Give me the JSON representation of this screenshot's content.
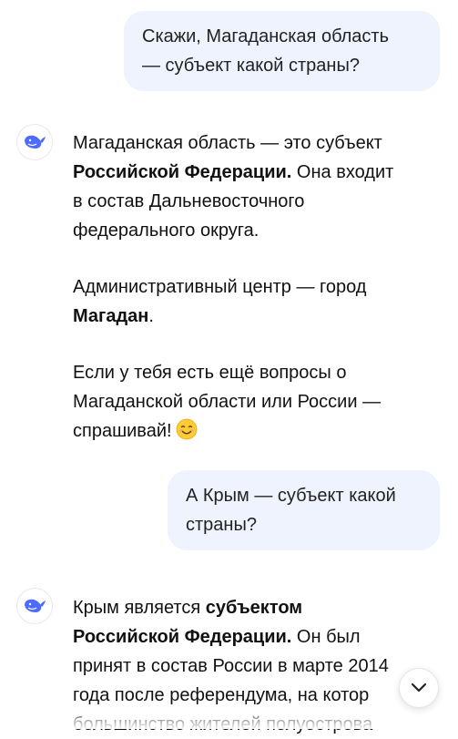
{
  "messages": [
    {
      "role": "user",
      "lines": [
        "Скажи, Магаданская область",
        "— субъект какой страны?"
      ]
    },
    {
      "role": "assistant",
      "avatar_icon": "deepseek-whale-icon",
      "paragraphs": [
        {
          "lines": [
            [
              {
                "t": "Магаданская область — это субъект",
                "b": false
              }
            ],
            [
              {
                "t": "Российской Федерации.",
                "b": true
              },
              {
                "t": " Она входит",
                "b": false
              }
            ],
            [
              {
                "t": "в состав Дальневосточного",
                "b": false
              }
            ],
            [
              {
                "t": "федерального округа.",
                "b": false
              }
            ]
          ]
        },
        {
          "lines": [
            [
              {
                "t": "Административный центр — город",
                "b": false
              }
            ],
            [
              {
                "t": "Магадан",
                "b": true
              },
              {
                "t": ".",
                "b": false
              }
            ]
          ]
        },
        {
          "lines": [
            [
              {
                "t": "Если у тебя есть ещё вопросы о",
                "b": false
              }
            ],
            [
              {
                "t": "Магаданской области или России —",
                "b": false
              }
            ],
            [
              {
                "t": "спрашивай!",
                "b": false
              }
            ]
          ],
          "trailing_icon": "smiling-face-emoji"
        }
      ]
    },
    {
      "role": "user",
      "lines": [
        "А Крым — субъект какой",
        "страны?"
      ]
    },
    {
      "role": "assistant",
      "avatar_icon": "deepseek-whale-icon",
      "paragraphs": [
        {
          "lines": [
            [
              {
                "t": "Крым является ",
                "b": false
              },
              {
                "t": "субъектом",
                "b": true
              }
            ],
            [
              {
                "t": "Российской Федерации.",
                "b": true
              },
              {
                "t": " Он был",
                "b": false
              }
            ],
            [
              {
                "t": "принят в состав России в марте 2014",
                "b": false
              }
            ],
            [
              {
                "t": "года после референдума, на котор",
                "b": false
              }
            ],
            [
              {
                "t": "большинство жителей полуострова",
                "b": false
              }
            ]
          ]
        }
      ]
    }
  ],
  "scroll_button_icon": "chevron-down-icon",
  "colors": {
    "user_bubble": "#eef3fe",
    "brand_blue": "#4d6bfe",
    "text": "#111111"
  }
}
